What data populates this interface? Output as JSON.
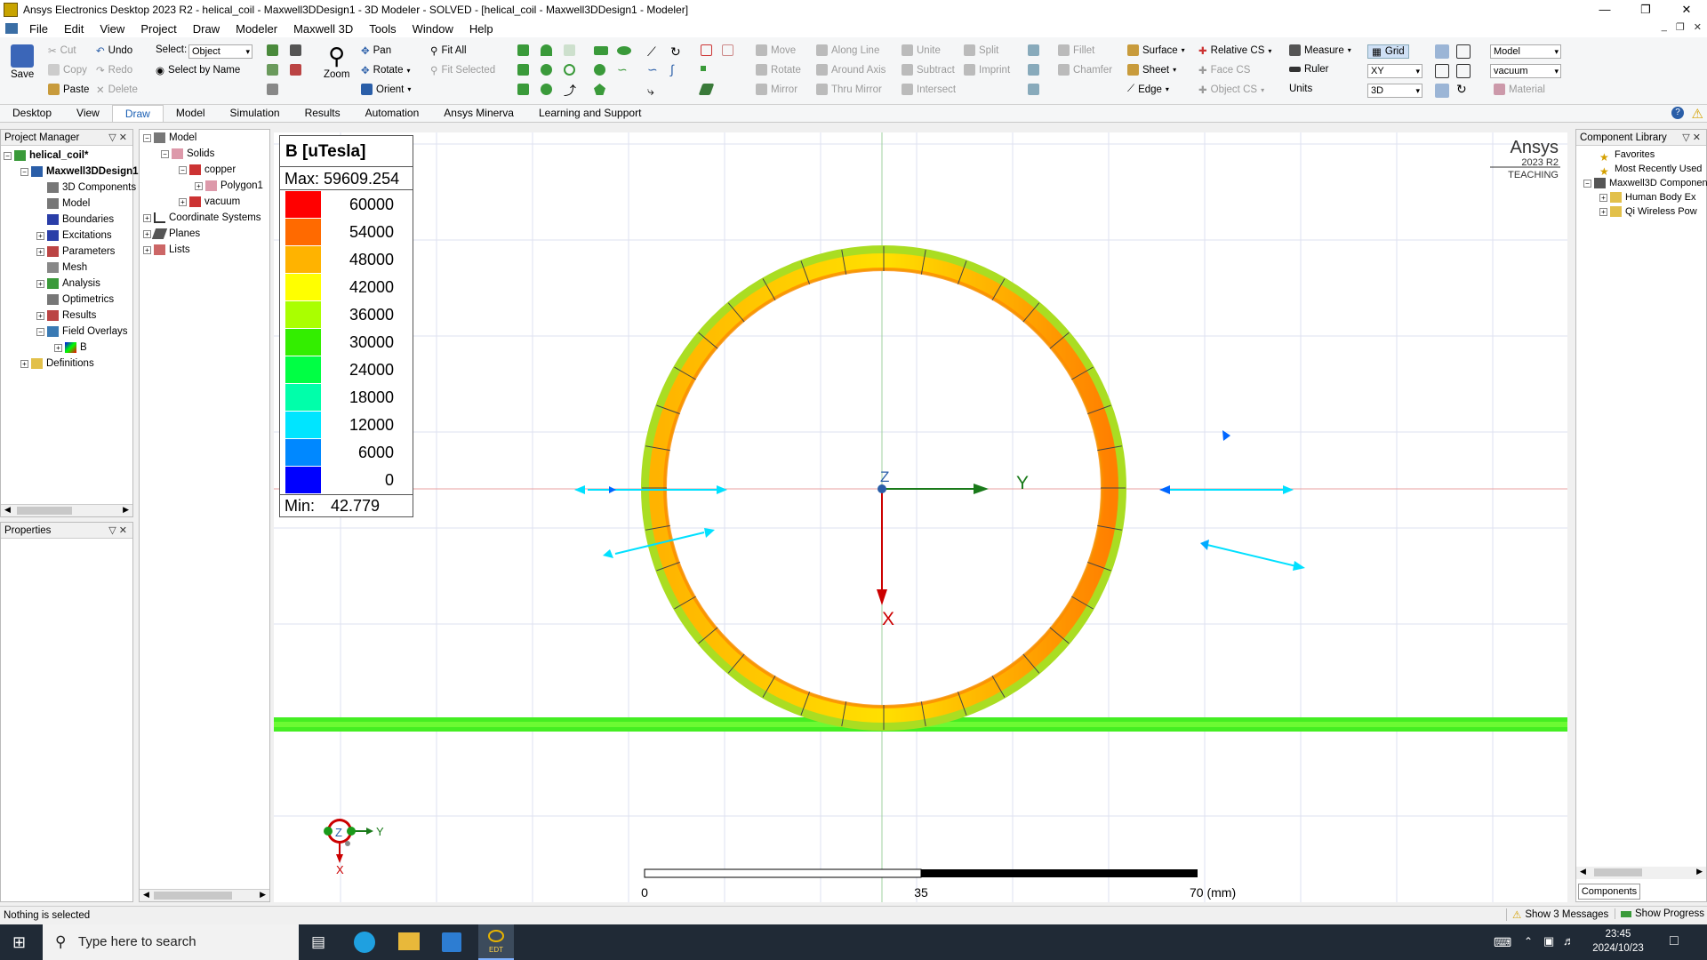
{
  "window": {
    "title": "Ansys Electronics Desktop 2023 R2 - helical_coil - Maxwell3DDesign1 - 3D Modeler - SOLVED - [helical_coil - Maxwell3DDesign1 - Modeler]"
  },
  "menu": [
    "File",
    "Edit",
    "View",
    "Project",
    "Draw",
    "Modeler",
    "Maxwell 3D",
    "Tools",
    "Window",
    "Help"
  ],
  "ribbon": {
    "save": "Save",
    "cut": "Cut",
    "copy": "Copy",
    "paste": "Paste",
    "undo": "Undo",
    "redo": "Redo",
    "delete": "Delete",
    "select_label": "Select:",
    "select_value": "Object",
    "select_by_name": "Select by Name",
    "pan": "Pan",
    "rotate": "Rotate",
    "orient": "Orient",
    "zoom": "Zoom",
    "fit_all": "Fit All",
    "fit_selected": "Fit Selected",
    "move": "Move",
    "rotate2": "Rotate",
    "mirror": "Mirror",
    "along_line": "Along Line",
    "around_axis": "Around Axis",
    "thru_mirror": "Thru Mirror",
    "unite": "Unite",
    "subtract": "Subtract",
    "intersect": "Intersect",
    "split": "Split",
    "imprint": "Imprint",
    "fillet": "Fillet",
    "chamfer": "Chamfer",
    "surface": "Surface",
    "sheet": "Sheet",
    "edge": "Edge",
    "relative_cs": "Relative CS",
    "face_cs": "Face CS",
    "object_cs": "Object CS",
    "measure": "Measure",
    "ruler": "Ruler",
    "units": "Units",
    "grid": "Grid",
    "plane": "XY",
    "dim": "3D",
    "model_sel": "Model",
    "material_sel": "vacuum",
    "material": "Material"
  },
  "tabs": [
    "Desktop",
    "View",
    "Draw",
    "Model",
    "Simulation",
    "Results",
    "Automation",
    "Ansys Minerva",
    "Learning and Support"
  ],
  "project_manager": {
    "title": "Project Manager",
    "items": [
      "helical_coil*",
      "Maxwell3DDesign1",
      "3D Components",
      "Model",
      "Boundaries",
      "Excitations",
      "Parameters",
      "Mesh",
      "Analysis",
      "Optimetrics",
      "Results",
      "Field Overlays",
      "B",
      "Definitions"
    ]
  },
  "model_tree": {
    "items": [
      "Model",
      "Solids",
      "copper",
      "Polygon1",
      "vacuum",
      "Coordinate Systems",
      "Planes",
      "Lists"
    ]
  },
  "properties": {
    "title": "Properties"
  },
  "component_library": {
    "title": "Component Library",
    "items": [
      "Favorites",
      "Most Recently Used",
      "Maxwell3D Components",
      "Human Body Ex",
      "Qi Wireless Pow"
    ],
    "tab": "Components"
  },
  "legend": {
    "title": "B [uTesla]",
    "max": "Max: 59609.254",
    "min_label": "Min:",
    "min_value": "42.779",
    "levels": [
      "60000",
      "54000",
      "48000",
      "42000",
      "36000",
      "30000",
      "24000",
      "18000",
      "12000",
      "6000",
      "0"
    ],
    "colors": [
      "#ff0000",
      "#ff6a00",
      "#ffb300",
      "#ffff00",
      "#aaff00",
      "#33ee00",
      "#00ff44",
      "#00ffaa",
      "#00e5ff",
      "#0088ff",
      "#0000ff"
    ]
  },
  "viewport": {
    "brand": "Ansys",
    "version": "2023 R2",
    "edition": "TEACHING",
    "axis_y": "Y",
    "axis_x": "X",
    "axis_z": "Z",
    "scale_0": "0",
    "scale_35": "35",
    "scale_70": "70 (mm)",
    "triad_z": "Z",
    "triad_y": "Y",
    "triad_x": "X"
  },
  "status": {
    "left": "Nothing is selected",
    "messages": "Show 3 Messages",
    "progress": "Show Progress"
  },
  "taskbar": {
    "search_placeholder": "Type here to search",
    "app_label": "EDT",
    "time": "23:45",
    "date": "2024/10/23"
  }
}
